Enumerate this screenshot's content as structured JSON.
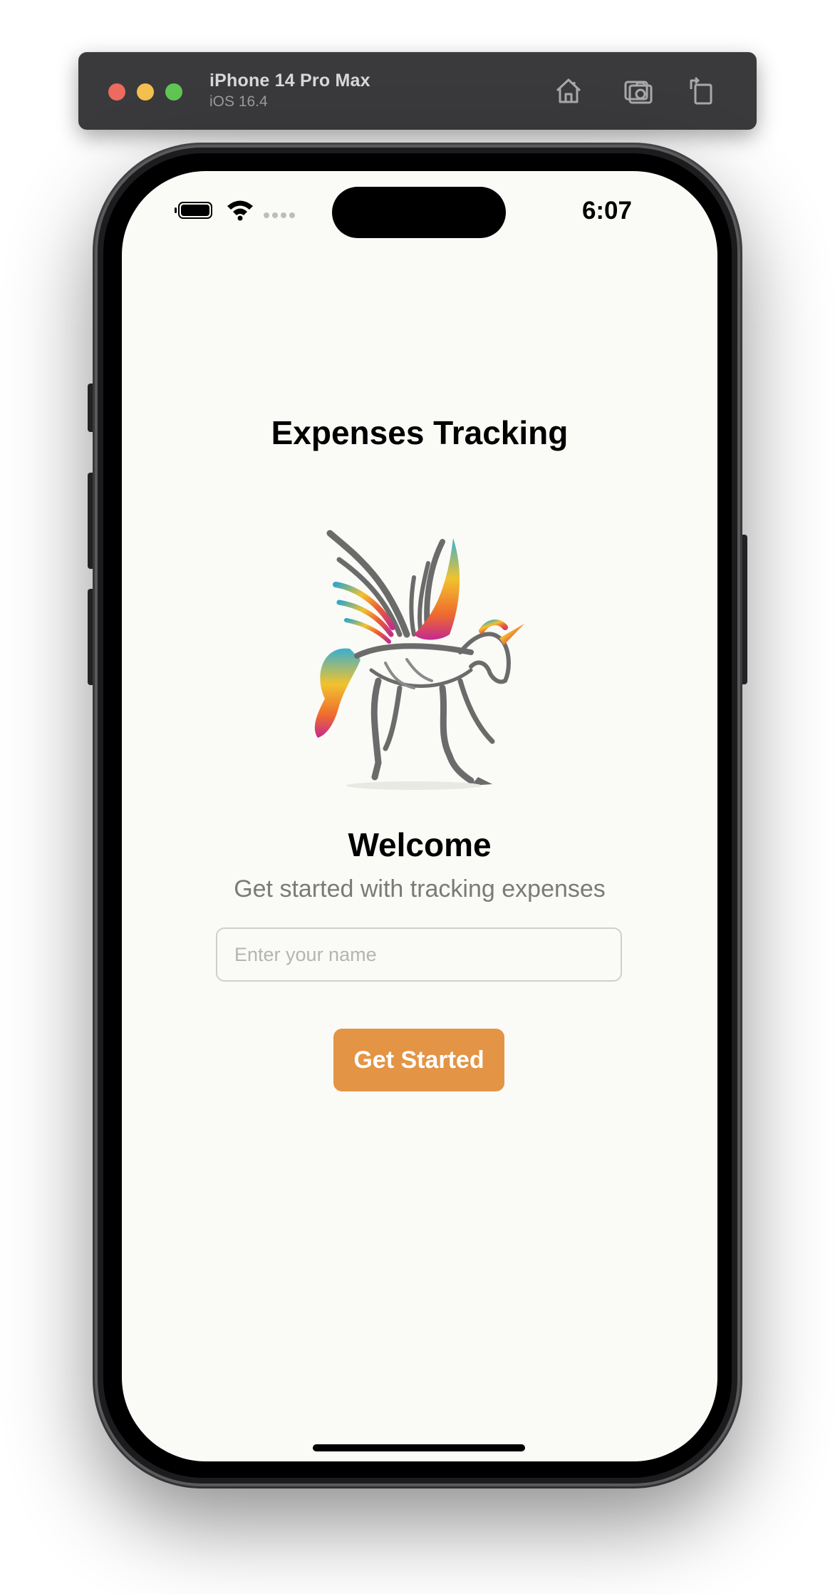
{
  "simulator": {
    "device_name": "iPhone 14 Pro Max",
    "os_version": "iOS 16.4",
    "buttons": [
      "home-icon",
      "screenshot-icon",
      "rotate-icon"
    ]
  },
  "status_bar": {
    "time": "6:07"
  },
  "app": {
    "title": "Expenses Tracking",
    "logo": "pegasus-unicorn-logo",
    "welcome": "Welcome",
    "subtitle": "Get started with tracking expenses",
    "name_input": {
      "placeholder": "Enter your name",
      "value": ""
    },
    "cta_label": "Get Started"
  },
  "colors": {
    "screen_bg": "#fafaf6",
    "accent": "#e49445",
    "subtitle": "#7a7a7a"
  }
}
